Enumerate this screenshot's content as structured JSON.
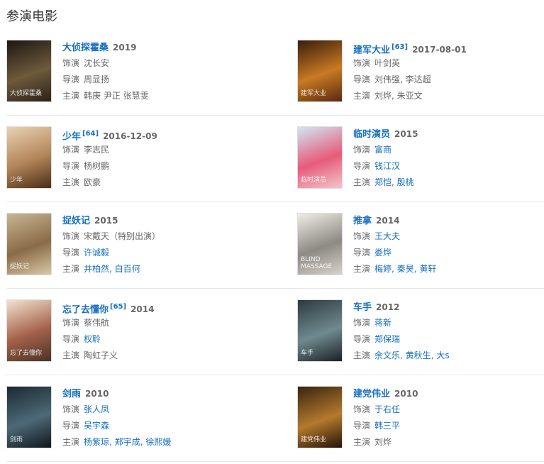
{
  "section_title": "参演电影",
  "labels": {
    "role": "饰演",
    "director": "导演",
    "starring": "主演"
  },
  "movies": [
    {
      "title": "大侦探霍桑",
      "ref": "",
      "year": "2019",
      "role": "沈长安",
      "role_link": false,
      "director": [
        {
          "t": "周显扬",
          "link": false
        }
      ],
      "stars": [
        {
          "t": "韩庚 尹正 张慧雯",
          "link": false
        }
      ],
      "poster_text": "大侦探霍桑",
      "poster_colors": [
        "#1c1712",
        "#6e5a3c",
        "#2b2118"
      ]
    },
    {
      "title": "建军大业",
      "ref": "[63]",
      "year": "2017-08-01",
      "role": "叶剑英",
      "role_link": false,
      "director": [
        {
          "t": "刘伟强, 李达超",
          "link": false
        }
      ],
      "stars": [
        {
          "t": "刘烨, 朱亚文",
          "link": false
        }
      ],
      "poster_text": "建军大业",
      "poster_colors": [
        "#3a1d0c",
        "#c97a23",
        "#5b2a10"
      ]
    },
    {
      "title": "少年",
      "ref": "[64]",
      "year": "2016-12-09",
      "role": "李志民",
      "role_link": false,
      "director": [
        {
          "t": "杨树鹏",
          "link": false
        }
      ],
      "stars": [
        {
          "t": "欧豪",
          "link": false
        }
      ],
      "poster_text": "少年",
      "poster_colors": [
        "#e9d2b3",
        "#b28458",
        "#4a2d18"
      ]
    },
    {
      "title": "临时演员",
      "ref": "",
      "year": "2015",
      "role": "富商",
      "role_link": true,
      "director": [
        {
          "t": "钱江汉",
          "link": true
        }
      ],
      "stars": [
        {
          "t": "郑恺",
          "link": true
        },
        {
          "t": ", ",
          "link": false
        },
        {
          "t": "殷桃",
          "link": true
        }
      ],
      "poster_text": "临时演员",
      "poster_colors": [
        "#cfe6f5",
        "#e75b7a",
        "#f1c6c9"
      ]
    },
    {
      "title": "捉妖记",
      "ref": "",
      "year": "2015",
      "role": "宋戴天（特别出演）",
      "role_link": false,
      "director": [
        {
          "t": "许诚毅",
          "link": true
        }
      ],
      "stars": [
        {
          "t": "井柏然",
          "link": true
        },
        {
          "t": ", ",
          "link": false
        },
        {
          "t": "白百何",
          "link": true
        }
      ],
      "poster_text": "捉妖记",
      "poster_colors": [
        "#c8b593",
        "#8a6b47",
        "#d9c9a8"
      ]
    },
    {
      "title": "推拿",
      "ref": "",
      "year": "2014",
      "role": "王大夫",
      "role_link": true,
      "director": [
        {
          "t": "娄烨",
          "link": true
        }
      ],
      "stars": [
        {
          "t": "梅婷",
          "link": true
        },
        {
          "t": ", ",
          "link": false
        },
        {
          "t": "秦昊",
          "link": true
        },
        {
          "t": ", ",
          "link": false
        },
        {
          "t": "黄轩",
          "link": true
        }
      ],
      "poster_text": "BLIND MASSAGE",
      "poster_colors": [
        "#f0ede6",
        "#8d8a83",
        "#d8d3ca"
      ]
    },
    {
      "title": "忘了去懂你",
      "ref": "[65]",
      "year": "2014",
      "role": "蔡伟航",
      "role_link": false,
      "director": [
        {
          "t": "权聆",
          "link": true
        }
      ],
      "stars": [
        {
          "t": "陶虹子义",
          "link": false
        }
      ],
      "poster_text": "忘了去懂你",
      "poster_colors": [
        "#f2e3cf",
        "#a3614a",
        "#4a3326"
      ]
    },
    {
      "title": "车手",
      "ref": "",
      "year": "2012",
      "role": "蒋新",
      "role_link": true,
      "director": [
        {
          "t": "郑保瑞",
          "link": true
        }
      ],
      "stars": [
        {
          "t": "余文乐",
          "link": true
        },
        {
          "t": ", ",
          "link": false
        },
        {
          "t": "黄秋生",
          "link": true
        },
        {
          "t": ", ",
          "link": false
        },
        {
          "t": "大s",
          "link": true
        }
      ],
      "poster_text": "车手",
      "poster_colors": [
        "#2d3a3f",
        "#6f8a8f",
        "#1a2226"
      ]
    },
    {
      "title": "剑雨",
      "ref": "",
      "year": "2010",
      "role": "张人凤",
      "role_link": true,
      "director": [
        {
          "t": "吴宇森",
          "link": true
        }
      ],
      "stars": [
        {
          "t": "杨紫琼",
          "link": true
        },
        {
          "t": ", ",
          "link": false
        },
        {
          "t": "郑宇成",
          "link": true
        },
        {
          "t": ", ",
          "link": false
        },
        {
          "t": "徐熙媛",
          "link": true
        }
      ],
      "poster_text": "剑雨",
      "poster_colors": [
        "#1b2a33",
        "#4d6977",
        "#0f171c"
      ]
    },
    {
      "title": "建党伟业",
      "ref": "",
      "year": "2010",
      "role": "于右任",
      "role_link": true,
      "director": [
        {
          "t": "韩三平",
          "link": true
        }
      ],
      "stars": [
        {
          "t": "刘烨",
          "link": false
        }
      ],
      "poster_text": "建党伟业",
      "poster_colors": [
        "#3a2410",
        "#b47a2d",
        "#241407"
      ]
    }
  ]
}
